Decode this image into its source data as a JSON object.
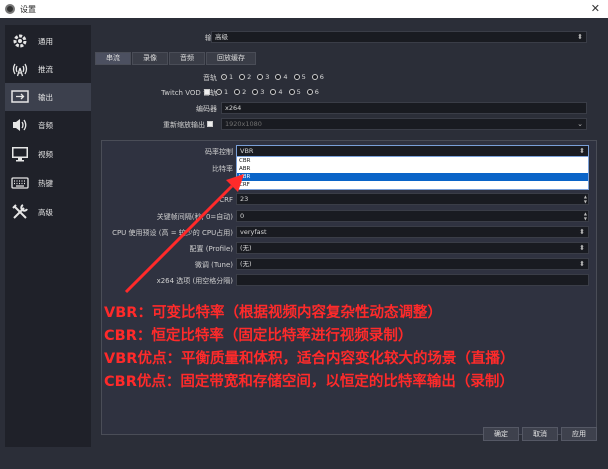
{
  "window": {
    "title": "设置",
    "close_glyph": "✕"
  },
  "sidebar": {
    "items": [
      {
        "label": "通用",
        "icon": "gear-icon"
      },
      {
        "label": "推流",
        "icon": "broadcast-icon"
      },
      {
        "label": "输出",
        "icon": "output-icon",
        "active": true
      },
      {
        "label": "音频",
        "icon": "speaker-icon"
      },
      {
        "label": "视频",
        "icon": "monitor-icon"
      },
      {
        "label": "热键",
        "icon": "keyboard-icon"
      },
      {
        "label": "高级",
        "icon": "tools-icon"
      }
    ]
  },
  "output_mode": {
    "label": "输出模式",
    "value": "高级"
  },
  "tabs": [
    "串流",
    "录像",
    "音频",
    "回放缓存"
  ],
  "audio_track": {
    "label": "音轨",
    "options": [
      "1",
      "2",
      "3",
      "4",
      "5",
      "6"
    ]
  },
  "twitch_track": {
    "label": "Twitch VOD 音轨",
    "options": [
      "1",
      "2",
      "3",
      "4",
      "5",
      "6"
    ]
  },
  "encoder": {
    "label": "编码器",
    "value": "x264"
  },
  "rescale": {
    "label": "重新缩放输出",
    "value": "1920x1080"
  },
  "rate_control": {
    "label": "码率控制",
    "value": "VBR",
    "options": [
      "CBR",
      "ABR",
      "VBR",
      "CRF"
    ],
    "selected": "VBR"
  },
  "bitrate": {
    "label": "比特率"
  },
  "crf": {
    "label": "CRF",
    "value": "23"
  },
  "keyframe": {
    "label": "关键帧间隔(秒, 0=自动)",
    "value": "0"
  },
  "cpu_preset": {
    "label": "CPU 使用预设 (高 = 较少的 CPU占用)",
    "value": "veryfast"
  },
  "profile": {
    "label": "配置 (Profile)",
    "value": "(无)"
  },
  "tune": {
    "label": "微调 (Tune)",
    "value": "(无)"
  },
  "x264_options": {
    "label": "x264 选项 (用空格分隔)",
    "value": ""
  },
  "annotations": [
    "VBR：可变比特率（根据视频内容复杂性动态调整）",
    "CBR：恒定比特率（固定比特率进行视频录制）",
    "VBR优点：平衡质量和体积，适合内容变化较大的场景（直播）",
    "CBR优点：固定带宽和存储空间，以恒定的比特率输出（录制）"
  ],
  "buttons": {
    "ok": "确定",
    "cancel": "取消",
    "apply": "应用"
  },
  "colors": {
    "annotation": "#ff2a2a",
    "selection": "#0a64c8",
    "background": "#2b2e38"
  }
}
